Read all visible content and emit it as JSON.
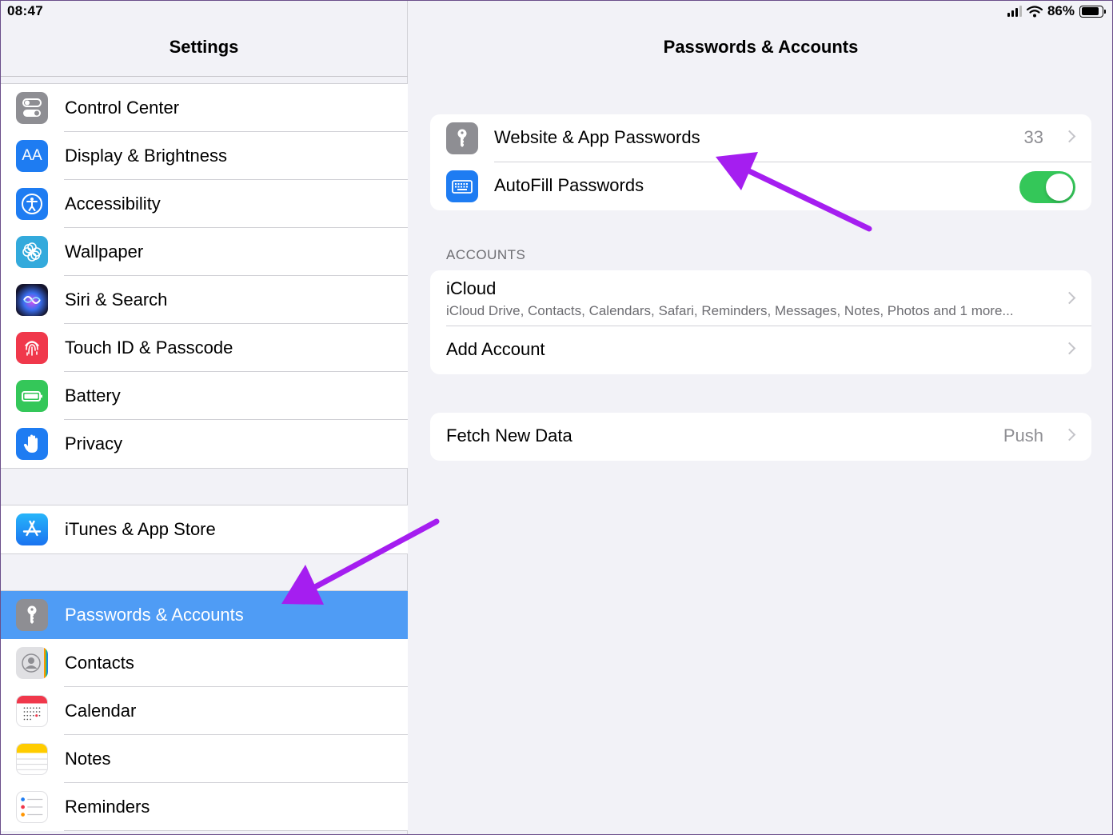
{
  "status_bar": {
    "time": "08:47",
    "battery_percent": "86%",
    "battery_level": 0.86
  },
  "sidebar": {
    "title": "Settings",
    "group1": [
      {
        "label": "Control Center",
        "icon": "control-center-icon",
        "color": "#8e8e93"
      },
      {
        "label": "Display & Brightness",
        "icon": "display-icon",
        "color": "#1e7cf2"
      },
      {
        "label": "Accessibility",
        "icon": "accessibility-icon",
        "color": "#1e7cf2"
      },
      {
        "label": "Wallpaper",
        "icon": "wallpaper-icon",
        "color": "#33aadc"
      },
      {
        "label": "Siri & Search",
        "icon": "siri-icon",
        "color": "#1c1c3a"
      },
      {
        "label": "Touch ID & Passcode",
        "icon": "fingerprint-icon",
        "color": "#f0384b"
      },
      {
        "label": "Battery",
        "icon": "battery-icon",
        "color": "#34c759"
      },
      {
        "label": "Privacy",
        "icon": "privacy-hand-icon",
        "color": "#1e7cf2"
      }
    ],
    "group2": [
      {
        "label": "iTunes & App Store",
        "icon": "app-store-icon",
        "color": "#1e8ef5"
      }
    ],
    "group3": [
      {
        "label": "Passwords & Accounts",
        "icon": "key-icon",
        "color": "#8e8e93",
        "selected": true
      },
      {
        "label": "Contacts",
        "icon": "contacts-icon",
        "color": "#d9d9dc"
      },
      {
        "label": "Calendar",
        "icon": "calendar-icon",
        "color": "#ffffff"
      },
      {
        "label": "Notes",
        "icon": "notes-icon",
        "color": "#ffffff"
      },
      {
        "label": "Reminders",
        "icon": "reminders-icon",
        "color": "#ffffff"
      }
    ]
  },
  "detail": {
    "title": "Passwords & Accounts",
    "passwords": {
      "website_label": "Website & App Passwords",
      "website_count": "33",
      "autofill_label": "AutoFill Passwords",
      "autofill_on": true
    },
    "accounts_header": "ACCOUNTS",
    "icloud": {
      "label": "iCloud",
      "detail": "iCloud Drive, Contacts, Calendars, Safari, Reminders, Messages, Notes, Photos and 1 more..."
    },
    "add_account": "Add Account",
    "fetch": {
      "label": "Fetch New Data",
      "value": "Push"
    }
  },
  "colors": {
    "selected": "#4f9cf5",
    "toggle_on": "#34c759",
    "annotation_arrow": "#a51ef0"
  }
}
